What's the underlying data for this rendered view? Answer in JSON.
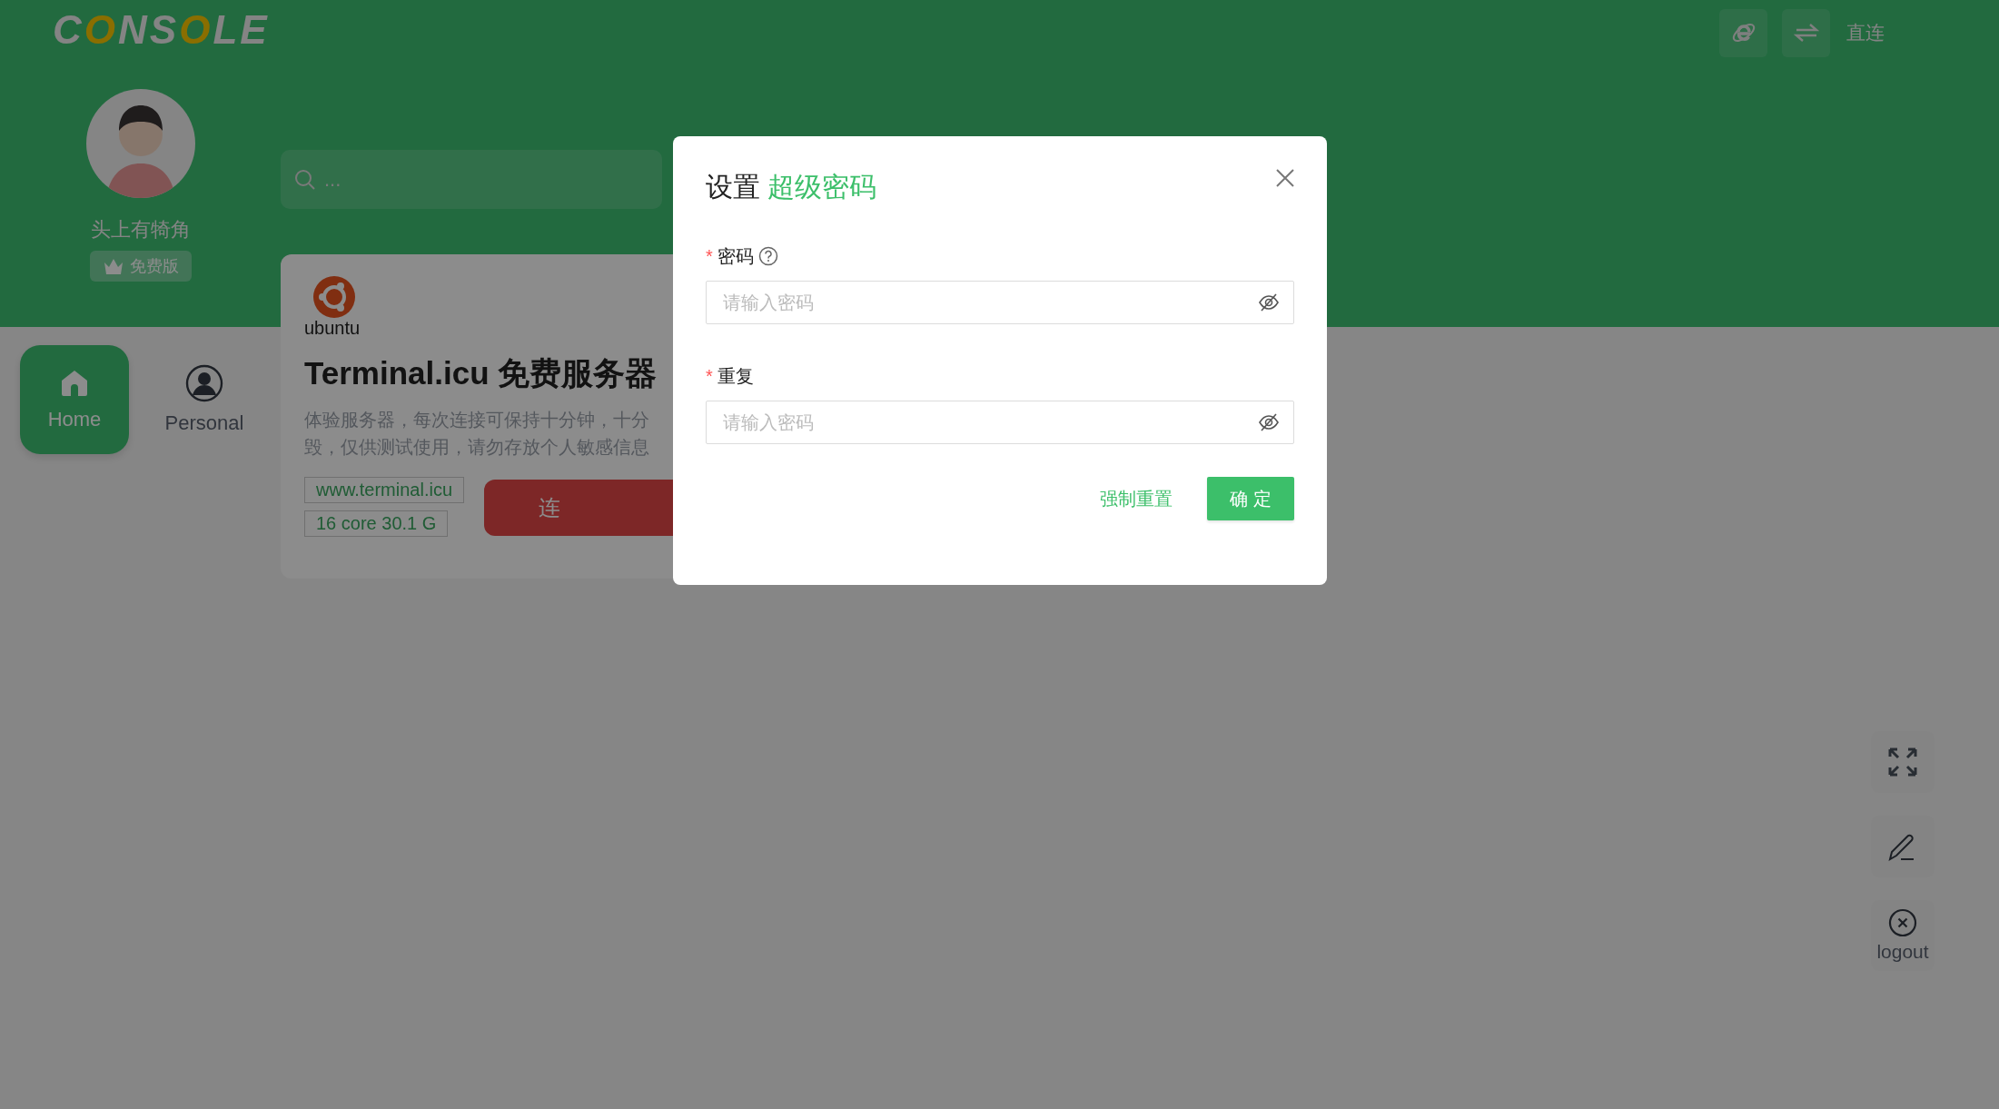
{
  "header": {
    "logo": [
      {
        "letter": "C",
        "accent": false
      },
      {
        "letter": "O",
        "accent": true
      },
      {
        "letter": "N",
        "accent": false
      },
      {
        "letter": "S",
        "accent": false
      },
      {
        "letter": "O",
        "accent": true
      },
      {
        "letter": "L",
        "accent": false
      },
      {
        "letter": "E",
        "accent": false
      }
    ],
    "actions": [
      {
        "kind": "browser"
      },
      {
        "kind": "swap"
      }
    ],
    "mode_label": "直连"
  },
  "profile": {
    "name": "头上有犄角",
    "plan": "免费版"
  },
  "nav": [
    {
      "label": "Home",
      "kind": "home",
      "selected": true
    },
    {
      "label": "Personal",
      "kind": "person",
      "selected": false
    }
  ],
  "search": {
    "placeholder": "..."
  },
  "server_card": {
    "os_label": "ubuntu",
    "title": "Terminal.icu 免费服务器",
    "description_lines": [
      "体验服务器，每次连接可保持十分钟，十分",
      "毁，仅供测试使用，请勿存放个人敏感信息"
    ],
    "tags": [
      "www.terminal.icu",
      "16 core 30.1 G"
    ],
    "connect_button": "连"
  },
  "side_tools": [
    {
      "kind": "fullscreen"
    },
    {
      "kind": "edit"
    },
    {
      "kind": "logout",
      "label": "logout"
    }
  ],
  "dialog": {
    "title": "设置",
    "title_highlight": "超级密码",
    "fields": [
      {
        "label": "密码",
        "required_mark": "*",
        "help": true,
        "placeholder": "请输入密码"
      },
      {
        "label": "重复",
        "required_mark": "*",
        "help": false,
        "placeholder": "请输入密码"
      }
    ],
    "secondary_action": "强制重置",
    "primary_action": "确 定"
  }
}
